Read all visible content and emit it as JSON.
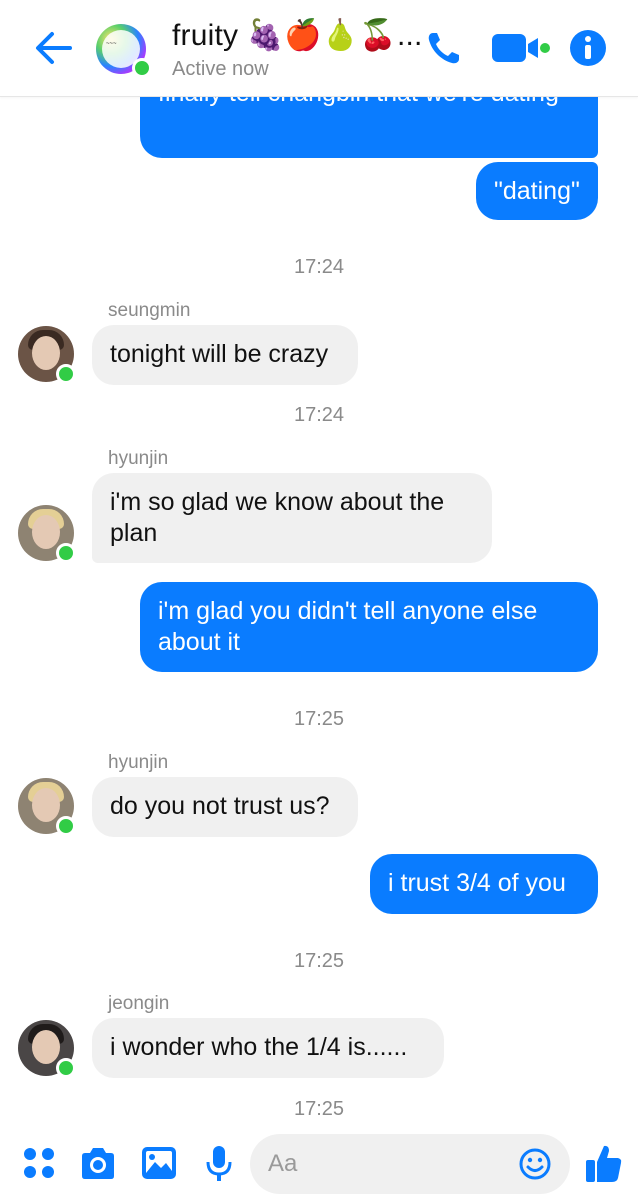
{
  "header": {
    "title": "fruity 🍇🍎🍐🍒...",
    "status": "Active now",
    "accent": "#0a7cff"
  },
  "messages": {
    "m1": "finally tell changbin that we're dating",
    "m2": "\"dating\"",
    "t1": "17:24",
    "s1": "seungmin",
    "m3": "tonight will be crazy",
    "t2": "17:24",
    "s2": "hyunjin",
    "m4": "i'm so glad we know about the plan",
    "m5": "i'm glad you didn't tell anyone else about it",
    "t3": "17:25",
    "s3": "hyunjin",
    "m6": "do you not trust us?",
    "m7": "i trust 3/4 of you",
    "t4": "17:25",
    "s4": "jeongin",
    "m8": "i wonder who the 1/4 is......",
    "t5": "17:25"
  },
  "composer": {
    "placeholder": "Aa"
  },
  "icons": {
    "back": "arrow-left-icon",
    "call": "phone-icon",
    "video": "video-camera-icon",
    "info": "info-icon",
    "menu": "four-dots-icon",
    "camera": "camera-icon",
    "gallery": "image-icon",
    "mic": "microphone-icon",
    "emoji": "emoji-icon",
    "like": "thumbs-up-icon"
  }
}
